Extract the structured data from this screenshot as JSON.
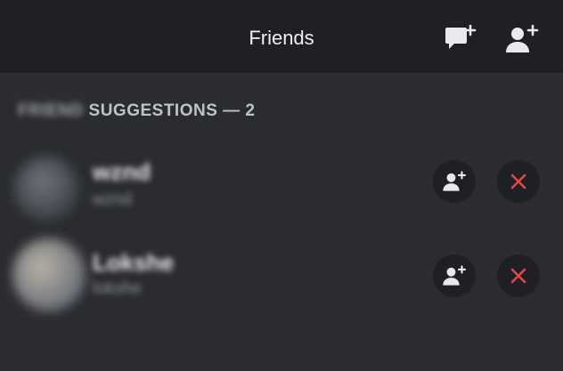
{
  "header": {
    "title": "Friends",
    "new_dm_icon": "new-message-icon",
    "add_friend_icon": "add-friend-icon"
  },
  "section": {
    "label_blurred": "FRIEND",
    "label": "SUGGESTIONS — 2"
  },
  "suggestions": [
    {
      "display_name": "wznd",
      "username": "wznd"
    },
    {
      "display_name": "Lokshe",
      "username": "lokshe"
    }
  ],
  "colors": {
    "header_bg": "#1f2023",
    "page_bg": "#2a2b2f",
    "dismiss_red": "#e2474b",
    "icon_light": "#e8e9ec"
  }
}
